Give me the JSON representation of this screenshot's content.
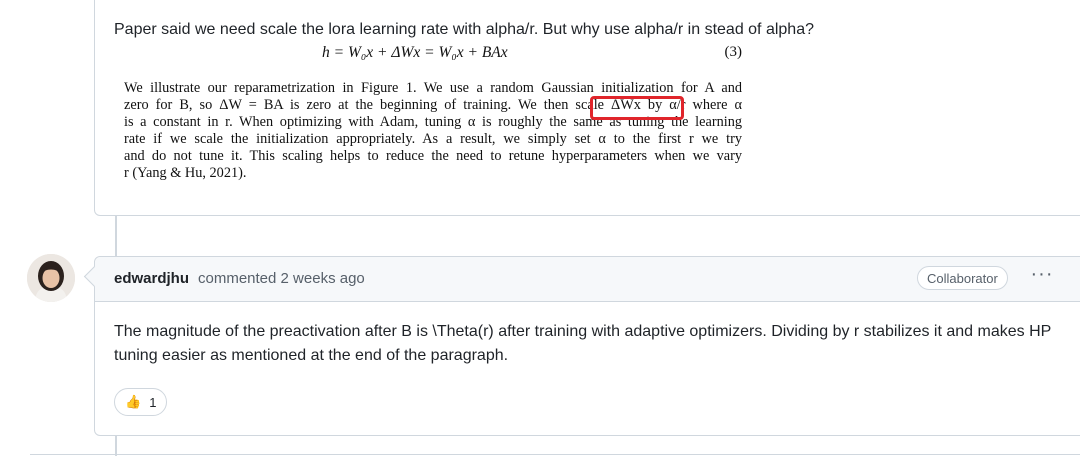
{
  "first_comment": {
    "question": "Paper said we need scale the lora learning rate with alpha/r. But why use alpha/r in stead of alpha?",
    "equation": "h = W₀x + ΔWx = W₀x + BAx",
    "equation_number": "(3)",
    "paper_lines": [
      "We illustrate our reparametrization in Figure 1. We use a random Gaussian initialization for A and",
      "zero for B, so ΔW = BA is zero at the beginning of training. We then scale ΔWx by α/r where α",
      "is a constant in r. When optimizing with Adam, tuning α is roughly the same as tuning the learning",
      "rate if we scale the initialization appropriately. As a result, we simply set α to the first r we try",
      "and do not tune it. This scaling helps to reduce the need to retune hyperparameters when we vary",
      "r (Yang & Hu, 2021)."
    ]
  },
  "second_comment": {
    "author": "edwardjhu",
    "meta": "commented 2 weeks ago",
    "badge": "Collaborator",
    "more_label": "···",
    "body": "The magnitude of the preactivation after B is \\Theta(r) after training with adaptive optimizers. Dividing by r stabilizes it and makes HP tuning easier as mentioned at the end of the paragraph.",
    "reaction": {
      "icon": "thumbs-up-icon",
      "emoji": "👍",
      "count": "1"
    }
  },
  "colors": {
    "highlight_box": "#e0252b",
    "border": "#d0d7de",
    "muted": "#57606a"
  }
}
